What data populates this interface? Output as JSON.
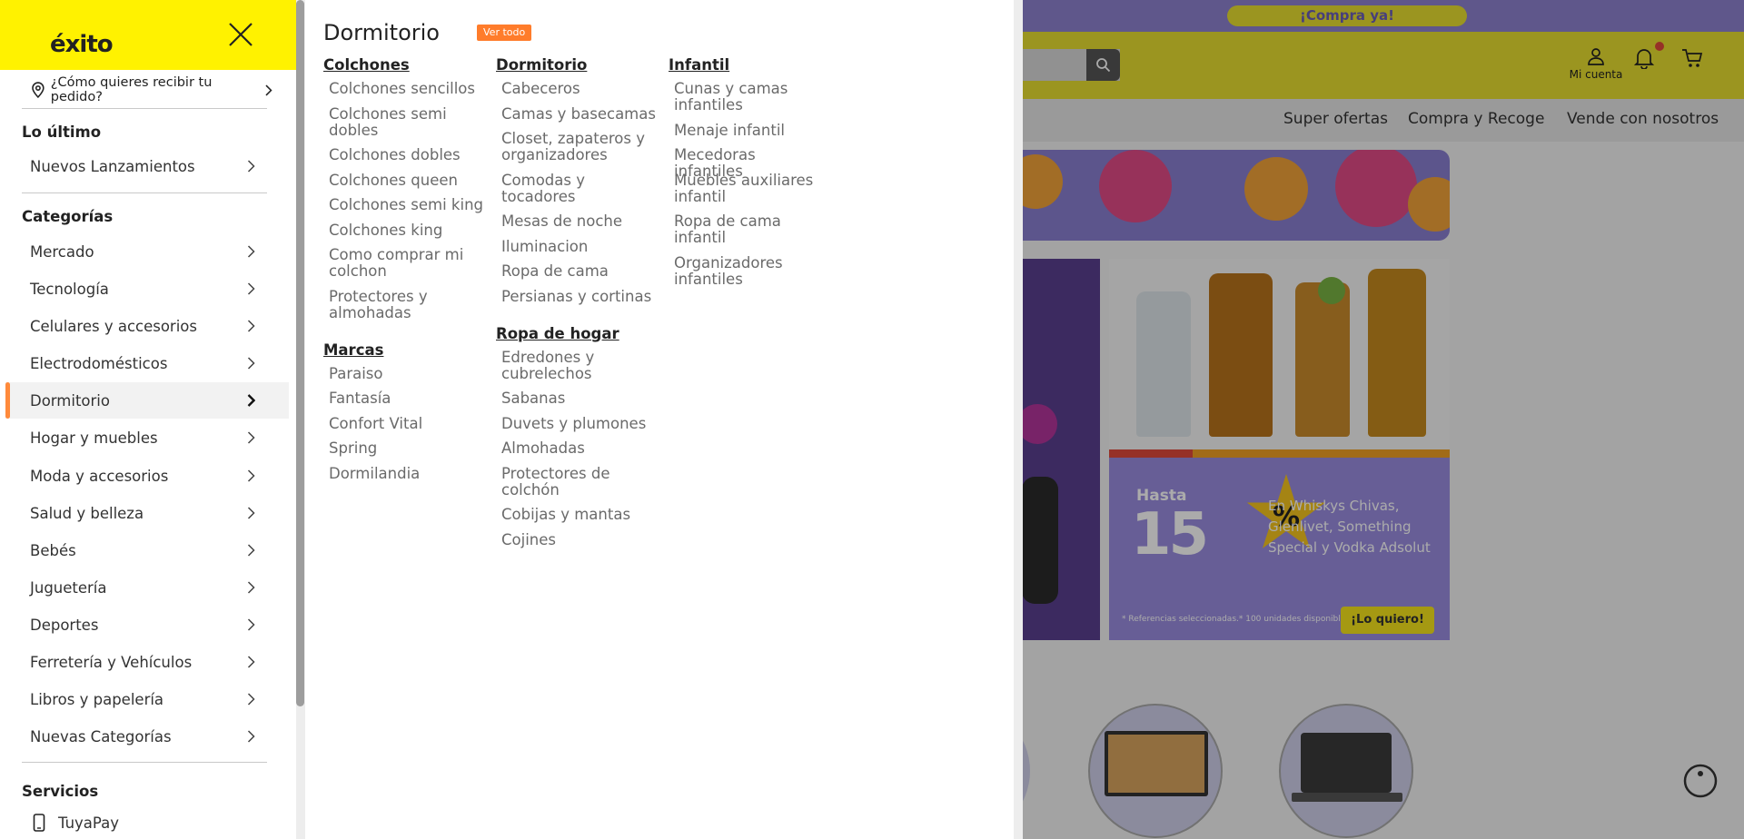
{
  "background": {
    "promo_cta": "¡Compra ya!",
    "account_label": "Mi cuenta",
    "nav_links": [
      "Super ofertas",
      "Compra y Recoge",
      "Vende con nosotros"
    ],
    "promo": {
      "hasta": "Hasta",
      "percent": "15",
      "percent_sign": "%",
      "copy": "En Whiskys Chivas, Glenlivet, Something Special y Vodka Adsolut",
      "legal": "* Referencias seleccionadas.* 100 unidades disponibles.",
      "cta": "¡Lo quiero!"
    },
    "colors": {
      "brand_yellow": "#fff200",
      "header_yellow": "#e8df31",
      "promo_purple": "#8e82cf",
      "accent_orange": "#ff8a3b"
    }
  },
  "sidebar": {
    "logo_text": "éxito",
    "delivery_prompt": "¿Cómo quieres recibir tu pedido?",
    "sections": {
      "latest_title": "Lo último",
      "categories_title": "Categorías",
      "services_title": "Servicios"
    },
    "latest": [
      {
        "label": "Nuevos Lanzamientos"
      }
    ],
    "categories": [
      {
        "label": "Mercado"
      },
      {
        "label": "Tecnología"
      },
      {
        "label": "Celulares y accesorios"
      },
      {
        "label": "Electrodomésticos"
      },
      {
        "label": "Dormitorio",
        "active": true
      },
      {
        "label": "Hogar y muebles"
      },
      {
        "label": "Moda y accesorios"
      },
      {
        "label": "Salud y belleza"
      },
      {
        "label": "Bebés"
      },
      {
        "label": "Juguetería"
      },
      {
        "label": "Deportes"
      },
      {
        "label": "Ferretería y Vehículos"
      },
      {
        "label": "Libros y papelería"
      },
      {
        "label": "Nuevas Categorías"
      }
    ],
    "services": [
      {
        "label": "TuyaPay",
        "icon": "phone-icon"
      }
    ]
  },
  "mega_menu": {
    "title": "Dormitorio",
    "see_all": "Ver todo",
    "columns": [
      {
        "groups": [
          {
            "heading": "Colchones",
            "items": [
              "Colchones sencillos",
              "Colchones semi dobles",
              "Colchones dobles",
              "Colchones queen",
              "Colchones semi king",
              "Colchones king",
              "Como comprar mi colchon",
              "Protectores y almohadas"
            ]
          },
          {
            "heading": "Marcas",
            "items": [
              "Paraiso",
              "Fantasía",
              "Confort Vital",
              "Spring",
              "Dormilandia"
            ]
          }
        ]
      },
      {
        "groups": [
          {
            "heading": "Dormitorio",
            "items": [
              "Cabeceros",
              "Camas y basecamas",
              "Closet, zapateros y organizadores",
              "Comodas y tocadores",
              "Mesas de noche",
              "Iluminacion",
              "Ropa de cama",
              "Persianas y cortinas"
            ]
          },
          {
            "heading": "Ropa de hogar",
            "items": [
              "Edredones y cubrelechos",
              "Sabanas",
              "Duvets y plumones",
              "Almohadas",
              "Protectores de colchón",
              "Cobijas y mantas",
              "Cojines"
            ]
          }
        ]
      },
      {
        "groups": [
          {
            "heading": "Infantil",
            "items": [
              "Cunas y camas infantiles",
              "Menaje infantil",
              "Mecedoras infantiles",
              "Muebles auxiliares infantil",
              "Ropa de cama infantil",
              "Organizadores infantiles"
            ]
          }
        ]
      }
    ]
  }
}
